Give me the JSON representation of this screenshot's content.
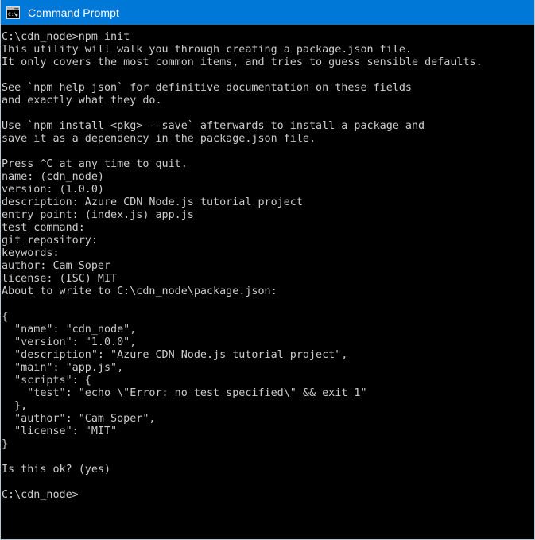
{
  "window": {
    "title": "Command Prompt",
    "icon": "console-window-icon",
    "colors": {
      "titlebar_background": "#0078d7",
      "titlebar_text": "#ffffff",
      "terminal_background": "#000000",
      "terminal_text": "#cccccc",
      "window_border": "#b9c6d1"
    }
  },
  "terminal": {
    "prompt_path": "C:\\cdn_node>",
    "command": "npm init",
    "lines": [
      "C:\\cdn_node>npm init",
      "This utility will walk you through creating a package.json file.",
      "It only covers the most common items, and tries to guess sensible defaults.",
      "",
      "See `npm help json` for definitive documentation on these fields",
      "and exactly what they do.",
      "",
      "Use `npm install <pkg> --save` afterwards to install a package and",
      "save it as a dependency in the package.json file.",
      "",
      "Press ^C at any time to quit.",
      "name: (cdn_node)",
      "version: (1.0.0)",
      "description: Azure CDN Node.js tutorial project",
      "entry point: (index.js) app.js",
      "test command:",
      "git repository:",
      "keywords:",
      "author: Cam Soper",
      "license: (ISC) MIT",
      "About to write to C:\\cdn_node\\package.json:",
      "",
      "{",
      "  \"name\": \"cdn_node\",",
      "  \"version\": \"1.0.0\",",
      "  \"description\": \"Azure CDN Node.js tutorial project\",",
      "  \"main\": \"app.js\",",
      "  \"scripts\": {",
      "    \"test\": \"echo \\\"Error: no test specified\\\" && exit 1\"",
      "  },",
      "  \"author\": \"Cam Soper\",",
      "  \"license\": \"MIT\"",
      "}",
      "",
      "Is this ok? (yes)",
      "",
      "C:\\cdn_node>"
    ],
    "prompts": [
      {
        "label": "name:",
        "default": "(cdn_node)",
        "answer": ""
      },
      {
        "label": "version:",
        "default": "(1.0.0)",
        "answer": ""
      },
      {
        "label": "description:",
        "default": "",
        "answer": "Azure CDN Node.js tutorial project"
      },
      {
        "label": "entry point:",
        "default": "(index.js)",
        "answer": "app.js"
      },
      {
        "label": "test command:",
        "default": "",
        "answer": ""
      },
      {
        "label": "git repository:",
        "default": "",
        "answer": ""
      },
      {
        "label": "keywords:",
        "default": "",
        "answer": ""
      },
      {
        "label": "author:",
        "default": "",
        "answer": "Cam Soper"
      },
      {
        "label": "license:",
        "default": "(ISC)",
        "answer": "MIT"
      },
      {
        "label": "Is this ok?",
        "default": "(yes)",
        "answer": ""
      }
    ],
    "package_json": {
      "name": "cdn_node",
      "version": "1.0.0",
      "description": "Azure CDN Node.js tutorial project",
      "main": "app.js",
      "scripts": {
        "test": "echo \"Error: no test specified\" && exit 1"
      },
      "author": "Cam Soper",
      "license": "MIT"
    },
    "output_path": "C:\\cdn_node\\package.json"
  }
}
